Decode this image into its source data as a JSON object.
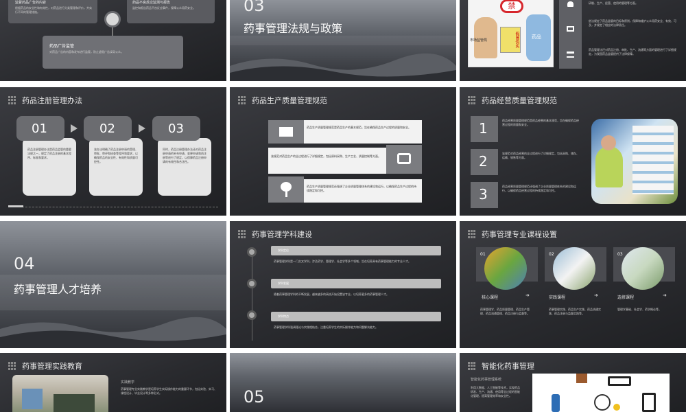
{
  "slide1": {
    "top_left_text": "监督药品广告的内容",
    "top_left_sub": "根据药品的安全性和有效性，对药品进行分类管理和评价，并实行不同的管理措施。",
    "top_right_text": "药品不良反应监测与报告",
    "top_right_sub": "监控和报告药品不良反应事件，保障公众用药安全。",
    "center_heading": "药品广告监管",
    "center_body": "对药品广告的内容和发布进行监管，防止虚假广告误导公众。"
  },
  "slide2": {
    "number": "03",
    "title": "药事管理法规与政策"
  },
  "slide3": {
    "cartoon_text_1": "禁",
    "cartoon_text_2": "市场监管局",
    "cartoon_text_3": "药品",
    "cartoon_text_4": "假冒伪劣",
    "para1": "研制、生产、经营、使用的管理等方面。",
    "para2": "依法规定了药品监管的目标和原则，保障和维护公众用药安全、有效、可及，并规定了相应的法律责任。",
    "para3": "药品管理法还对药品注册、审批、生产、流通等方面的管理进行了详细规定，为我国药品监管提供了法律保障。"
  },
  "slide4": {
    "title": "药品注册管理办法",
    "cards": [
      {
        "num": "01",
        "body": "药品注册管理办法是药品监管的重要法规之一，规定了药品注册的基本程序、标准和要求。"
      },
      {
        "num": "02",
        "body": "该办法明确了药品注册申请的受理、审批、审评和核查等程序和要求，以确保药品的安全性、有效性和质量可控性。"
      },
      {
        "num": "03",
        "body": "同时，药品注册管理办法还对药品注册申请的补充申请、变更申请和再注册等进行了规定，以保障药品注册申请的有效性和合法性。"
      }
    ]
  },
  "slide5": {
    "title": "药品生产质量管理规范",
    "items": [
      {
        "icon": "mail-icon",
        "body": "药品生产质量管理规范是药品生产的基本规范，旨在确保药品生产过程的质量和安全。"
      },
      {
        "icon": "camera-icon",
        "body": "该规范对药品生产的全过程进行了详细规定，包括原料采购、生产工艺、质量控制等方面。"
      },
      {
        "icon": "tree-icon",
        "body": "药品生产质量管理规范还强调了企业质量管理体系的建设和运行，以确保药品生产过程的持续稳定和可控。"
      }
    ]
  },
  "slide6": {
    "title": "药品经营质量管理规范",
    "items": [
      {
        "num": "1",
        "body": "药品经营质量管理规范是药品经营的基本规范，旨在确保药品经营过程的质量和安全。"
      },
      {
        "num": "2",
        "body": "该规范对药品经营的全过程进行了详细规定，包括采购、储存、运输、销售等方面。"
      },
      {
        "num": "3",
        "body": "药品经营质量管理规范还强调了企业质量管理体系的建设和运行，以确保药品经营过程的持续稳定和可控。"
      }
    ]
  },
  "slide7": {
    "number": "04",
    "title": "药事管理人才培养"
  },
  "slide8": {
    "title": "药事管理学科建设",
    "items": [
      {
        "label": "学科定位",
        "body": "药事管理学科是一门交叉学科，涉及药学、管理学、社会学等多个领域，旨在培养具有药事管理能力的专业人才。"
      },
      {
        "label": "学科发展",
        "body": "随着药事管理学科的不断发展，越来越多的高校开始设置该专业，以培养更多的药事管理人才。"
      },
      {
        "label": "学科特点",
        "body": "药事管理学科强调理论与实践相结合，注重培养学生的实际操作能力和问题解决能力。"
      }
    ]
  },
  "slide9": {
    "title": "药事管理专业课程设置",
    "courses": [
      {
        "num": "01",
        "name": "核心课程",
        "body": "药事管理学、药品质量管理、药品生产管理、药品流通管理、药品注册与监督等。"
      },
      {
        "num": "02",
        "name": "实践课程",
        "body": "药事管理实践、药品生产实践、药品流通实践、药品注册与监督实践等。"
      },
      {
        "num": "03",
        "name": "选修课程",
        "body": "管理学基础、社会学、药学概论等。"
      }
    ],
    "arrow": "➜"
  },
  "slide10": {
    "title": "药事管理实践教育",
    "label": "实践教学",
    "body": "药事管理专业实践教学是培养学生实际操作能力的重要环节，包括实验、实习、课程设计、毕业设计等多种形式。"
  },
  "slide11": {
    "number": "05"
  },
  "slide12": {
    "title": "智能化药事管理",
    "label": "智能化药事管理系统",
    "body": "利用大数据、人工智能等技术，实现药品研发、生产、流通、使用等全过程的智能化管理，提高管理效率和安全性。"
  }
}
